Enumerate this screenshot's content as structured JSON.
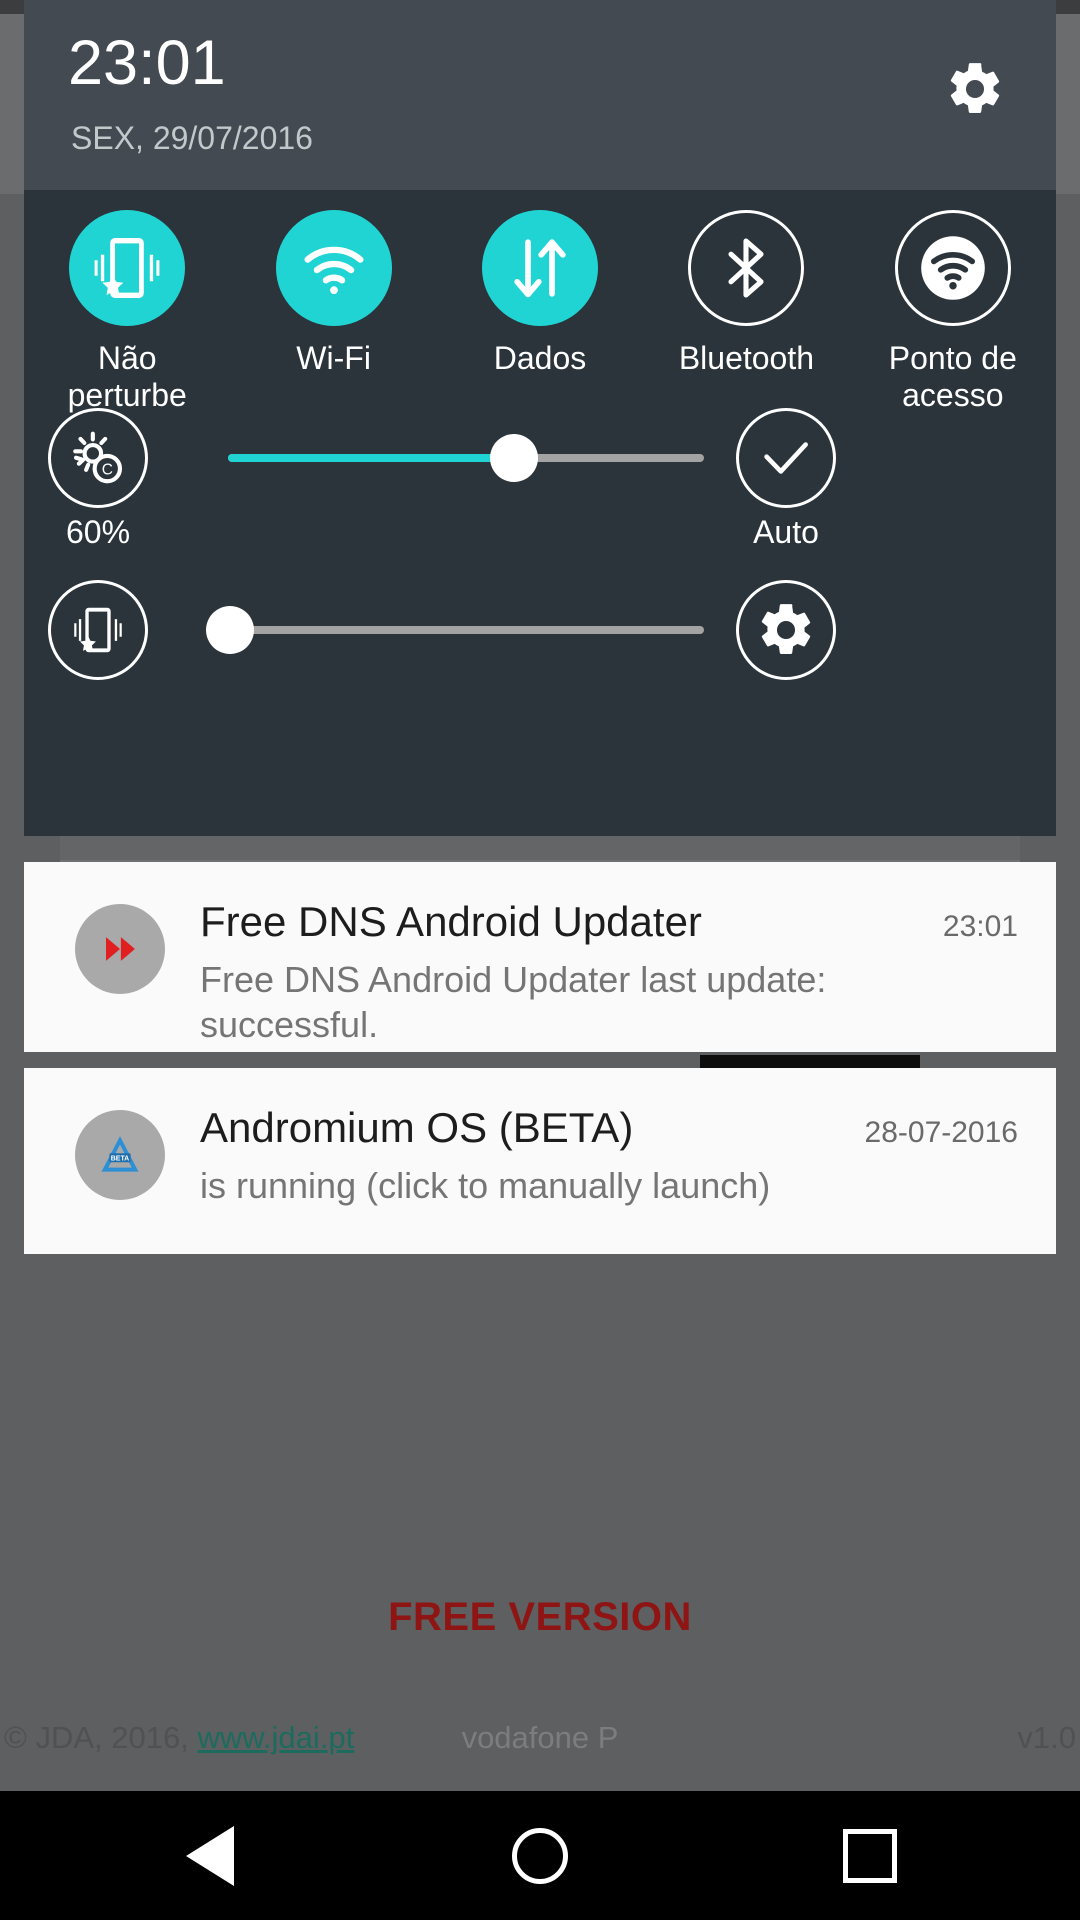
{
  "status_shade": {
    "clock": "23:01",
    "date": "SEX, 29/07/2016",
    "settings_icon": "gear-icon",
    "tiles": [
      {
        "label": "Não\nperturbe",
        "icon": "do-not-disturb-icon",
        "active": true
      },
      {
        "label": "Wi-Fi",
        "icon": "wifi-icon",
        "active": true
      },
      {
        "label": "Dados",
        "icon": "mobile-data-icon",
        "active": true
      },
      {
        "label": "Bluetooth",
        "icon": "bluetooth-icon",
        "active": false
      },
      {
        "label": "Ponto de\nacesso",
        "icon": "hotspot-icon",
        "active": false
      }
    ],
    "brightness": {
      "icon": "brightness-auto-icon",
      "value_label": "60%",
      "percent": 60,
      "auto_label": "Auto",
      "auto_icon": "check-icon"
    },
    "volume": {
      "icon": "vibrate-priority-icon",
      "percent": 0,
      "settings_icon": "gear-icon"
    }
  },
  "notifications": [
    {
      "title": "Free DNS Android Updater",
      "time": "23:01",
      "text": "Free DNS Android Updater last update: successful.",
      "icon": "fast-forward-icon"
    },
    {
      "title": "Andromium OS (BETA)",
      "time": "28-07-2016",
      "text": "is running (click to manually launch)",
      "icon": "andromium-beta-icon"
    }
  ],
  "background_app": {
    "free_version": "FREE VERSION",
    "footer_copyright": "© JDA, 2016, ",
    "footer_link": "www.jdai.pt",
    "footer_carrier": "vodafone P",
    "footer_version": "v1.0"
  },
  "navigation_bar": {
    "back": "back-button",
    "home": "home-button",
    "recents": "recents-button"
  },
  "colors": {
    "accent": "#21d4d4",
    "header_bg": "#434a51",
    "panel_bg": "#2b343a",
    "free_version": "#8f1414",
    "link": "#1d6b5f"
  }
}
